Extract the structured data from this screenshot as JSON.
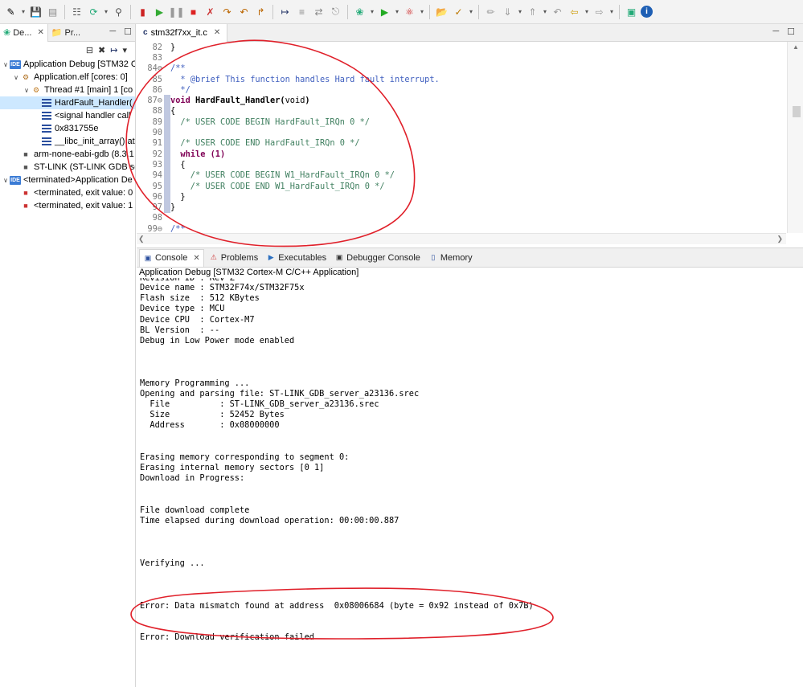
{
  "toolbar": {
    "icons": [
      "new-icon",
      "save-icon",
      "save-all-icon",
      "build-icon",
      "debug-config-icon",
      "filter-icon",
      "resume-icon",
      "suspend-icon",
      "terminate-icon",
      "disconnect-icon",
      "step-into-icon",
      "step-over-icon",
      "step-return-icon",
      "instruction-step-icon",
      "use-step-filters-icon",
      "restart-icon",
      "debug-icon",
      "run-icon",
      "external-tools-icon",
      "open-type-icon",
      "search-icon",
      "next-annotation-icon",
      "back-icon",
      "forward-icon",
      "pin-icon",
      "info-icon"
    ]
  },
  "left_pane": {
    "tab_debug": "De...",
    "tab_project": "Pr...",
    "tree": [
      {
        "label": "Application Debug [STM32 C",
        "indent": 0,
        "expanded": true,
        "icon": "ide-icon"
      },
      {
        "label": "Application.elf [cores: 0]",
        "indent": 1,
        "expanded": true,
        "icon": "elf-icon"
      },
      {
        "label": "Thread #1 [main] 1 [co",
        "indent": 2,
        "expanded": true,
        "icon": "thread-icon"
      },
      {
        "label": "HardFault_Handler(",
        "indent": 3,
        "selected": true,
        "icon": "stack-frame-icon"
      },
      {
        "label": "<signal handler call",
        "indent": 3,
        "icon": "stack-frame-icon"
      },
      {
        "label": "0x831755e",
        "indent": 3,
        "icon": "stack-frame-icon"
      },
      {
        "label": "__libc_init_array() at",
        "indent": 3,
        "icon": "stack-frame-icon"
      },
      {
        "label": "arm-none-eabi-gdb (8.3.1",
        "indent": 1,
        "icon": "gdb-process-icon"
      },
      {
        "label": "ST-LINK (ST-LINK GDB ser",
        "indent": 1,
        "icon": "gdb-process-icon"
      },
      {
        "label": "<terminated>Application De",
        "indent": 0,
        "expanded": true,
        "icon": "ide-icon"
      },
      {
        "label": "<terminated, exit value: 0",
        "indent": 1,
        "icon": "terminated-icon"
      },
      {
        "label": "<terminated, exit value: 1",
        "indent": 1,
        "icon": "terminated-icon"
      }
    ]
  },
  "editor": {
    "tab_label": "stm32f7xx_it.c",
    "lines": [
      {
        "n": "82",
        "text": "}",
        "cls": ""
      },
      {
        "n": "83",
        "text": "",
        "cls": ""
      },
      {
        "n": "84⊖",
        "text": "/**",
        "cls": "jd"
      },
      {
        "n": "85",
        "text": "  * @brief This function handles Hard fault interrupt.",
        "cls": "jd"
      },
      {
        "n": "86",
        "text": "  */",
        "cls": "jd"
      },
      {
        "n": "87⊖",
        "text": "void HardFault_Handler(void)",
        "cls": "sig"
      },
      {
        "n": "88",
        "text": "{",
        "cls": ""
      },
      {
        "n": "89",
        "text": "  /* USER CODE BEGIN HardFault_IRQn 0 */",
        "cls": "cm"
      },
      {
        "n": "90",
        "text": "",
        "cls": ""
      },
      {
        "n": "91",
        "text": "  /* USER CODE END HardFault_IRQn 0 */",
        "cls": "cm"
      },
      {
        "n": "92",
        "text": "  while (1)",
        "cls": "while"
      },
      {
        "n": "93",
        "text": "  {",
        "cls": ""
      },
      {
        "n": "94",
        "text": "    /* USER CODE BEGIN W1_HardFault_IRQn 0 */",
        "cls": "cm"
      },
      {
        "n": "95",
        "text": "    /* USER CODE END W1_HardFault_IRQn 0 */",
        "cls": "cm"
      },
      {
        "n": "96",
        "text": "  }",
        "cls": ""
      },
      {
        "n": "97",
        "text": "}",
        "cls": ""
      },
      {
        "n": "98",
        "text": "",
        "cls": ""
      },
      {
        "n": "99⊖",
        "text": "/**",
        "cls": "jd"
      }
    ]
  },
  "console": {
    "tabs": [
      {
        "label": "Console",
        "icon": "console-icon",
        "active": true
      },
      {
        "label": "Problems",
        "icon": "problems-icon"
      },
      {
        "label": "Executables",
        "icon": "executables-icon"
      },
      {
        "label": "Debugger Console",
        "icon": "debugger-console-icon"
      },
      {
        "label": "Memory",
        "icon": "memory-icon"
      }
    ],
    "header": "Application Debug [STM32 Cortex-M C/C++ Application]",
    "output": [
      "Revision ID : Rev Z",
      "Device name : STM32F74x/STM32F75x",
      "Flash size  : 512 KBytes",
      "Device type : MCU",
      "Device CPU  : Cortex-M7",
      "BL Version  : --",
      "Debug in Low Power mode enabled",
      "",
      "",
      "",
      "Memory Programming ...",
      "Opening and parsing file: ST-LINK_GDB_server_a23136.srec",
      "  File          : ST-LINK_GDB_server_a23136.srec",
      "  Size          : 52452 Bytes",
      "  Address       : 0x08000000",
      "",
      "",
      "Erasing memory corresponding to segment 0:",
      "Erasing internal memory sectors [0 1]",
      "Download in Progress:",
      "",
      "",
      "File download complete",
      "Time elapsed during download operation: 00:00:00.887",
      "",
      "",
      "",
      "Verifying ...",
      "",
      "",
      "",
      "Error: Data mismatch found at address  0x08006684 (byte = 0x92 instead of 0x7B)",
      "",
      "",
      "Error: Download verification failed"
    ]
  },
  "colors": {
    "annotation": "#e0202a",
    "selection": "#cde8ff",
    "keyword": "#7f0055",
    "comment": "#3f7f5f",
    "javadoc": "#3f5fbf"
  }
}
